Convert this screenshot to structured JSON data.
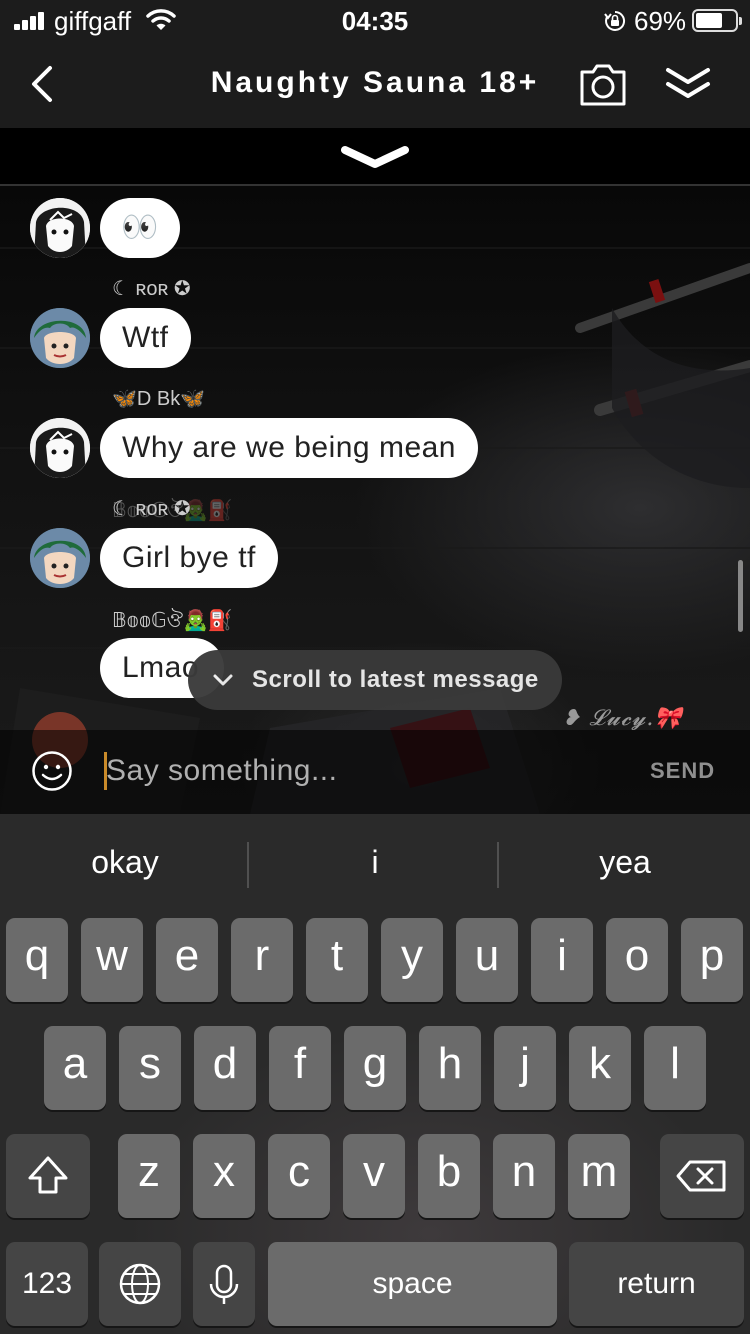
{
  "status_bar": {
    "carrier": "giffgaff",
    "time": "04:35",
    "battery_percent": "69%",
    "battery_level": 0.69
  },
  "header": {
    "title": "Naughty Sauna 18+",
    "icons": [
      "back-chevron-icon",
      "camera-icon",
      "double-chevron-down-icon"
    ]
  },
  "chat": {
    "messages": [
      {
        "sender": "",
        "text": "👀",
        "avatar": "avatar-manga-girl"
      },
      {
        "sender": "☾ ʀᴏʀ ✪",
        "text": "Wtf",
        "avatar": "avatar-green-hair"
      },
      {
        "sender": "🦋D Bk🦋",
        "text": "Why are we being mean",
        "avatar": "avatar-manga-girl"
      },
      {
        "sender": "☾ ʀᴏʀ ✪",
        "text": "Girl bye tf",
        "avatar": "avatar-green-hair"
      },
      {
        "sender": "𝔹𝕠𝕠𝔾ঔ🧟‍♂️⛽",
        "text": "Lmao",
        "avatar": ""
      }
    ],
    "ghost_sender": "𝔹𝕠𝕠𝔾ঔ🧟‍♂️⛽",
    "trailing_sender": "❥ 𝓛𝓾𝓬𝔂.🎀",
    "scroll_to_latest": "Scroll to latest message"
  },
  "composer": {
    "placeholder": "Say something...",
    "send_label": "SEND"
  },
  "keyboard": {
    "suggestions": [
      "okay",
      "i",
      "yea"
    ],
    "row1": [
      "q",
      "w",
      "e",
      "r",
      "t",
      "y",
      "u",
      "i",
      "o",
      "p"
    ],
    "row2": [
      "a",
      "s",
      "d",
      "f",
      "g",
      "h",
      "j",
      "k",
      "l"
    ],
    "row3": [
      "z",
      "x",
      "c",
      "v",
      "b",
      "n",
      "m"
    ],
    "numbers_label": "123",
    "space_label": "space",
    "return_label": "return"
  }
}
